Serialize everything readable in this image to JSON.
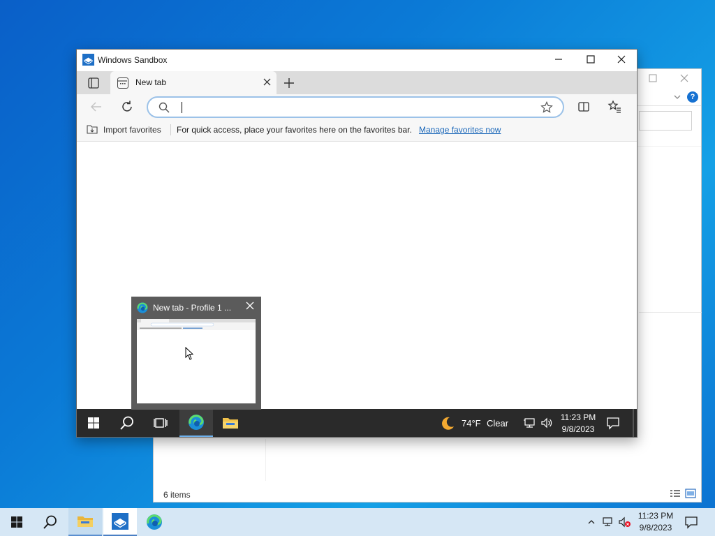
{
  "explorer": {
    "status_text": "6 items"
  },
  "sandbox": {
    "title": "Windows Sandbox",
    "window_controls": {
      "minimize": "—",
      "maximize": "☐",
      "close": "✕"
    }
  },
  "browser": {
    "tab": {
      "title": "New tab",
      "close": "✕"
    },
    "new_tab": "+",
    "address": {
      "value": "",
      "placeholder": ""
    },
    "favorites_bar": {
      "import_label": "Import favorites",
      "message": "For quick access, place your favorites here on the favorites bar.",
      "link": "Manage favorites now"
    }
  },
  "sandbox_taskbar": {
    "weather_temp": "74°F",
    "weather_condition": "Clear",
    "time": "11:23 PM",
    "date": "9/8/2023"
  },
  "thumbnail": {
    "title": "New tab - Profile 1 ...",
    "close": "✕"
  },
  "host_taskbar": {
    "time": "11:23 PM",
    "date": "9/8/2023",
    "tray_chevron": "^"
  },
  "colors": {
    "accent": "#0078d4",
    "link": "#1a67b9",
    "taskbar_dark": "#2a2a2a",
    "host_taskbar": "#d6e7f5"
  }
}
